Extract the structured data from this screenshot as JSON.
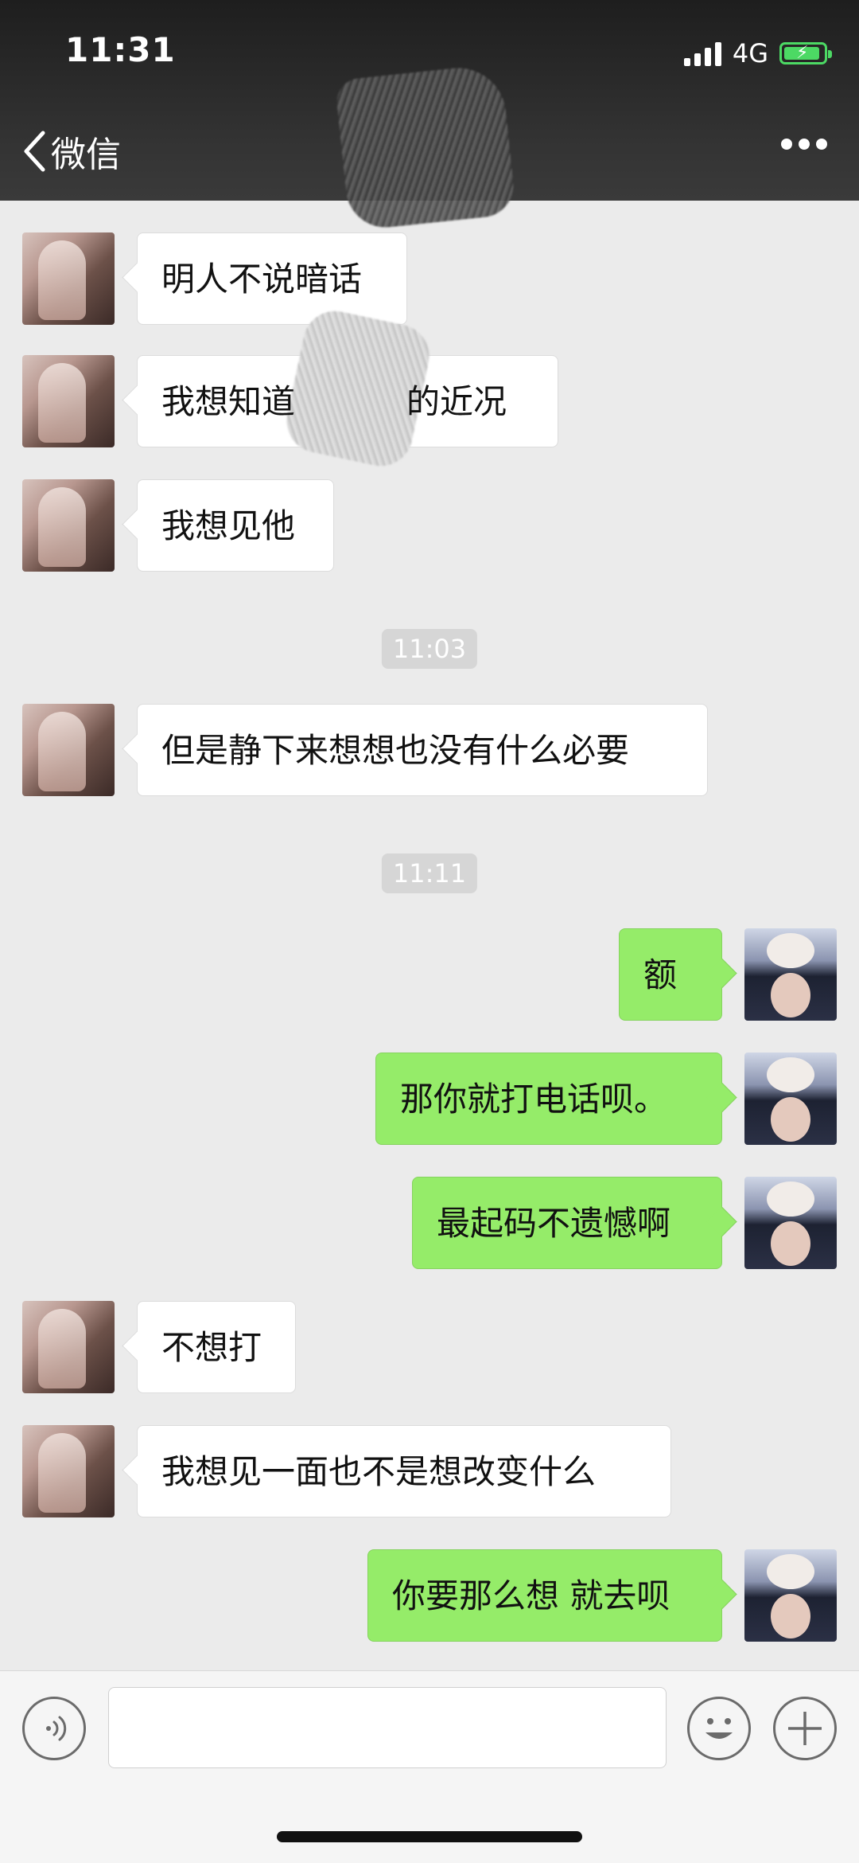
{
  "status_bar": {
    "time": "11:31",
    "network": "4G",
    "battery_color": "#4cd964"
  },
  "nav": {
    "back_label": "微信",
    "more_icon": "more-icon"
  },
  "messages": [
    {
      "side": "left",
      "text": "明人不说暗话"
    },
    {
      "side": "left",
      "text": "我想知道",
      "text_end": "的近况"
    },
    {
      "side": "left",
      "text": "我想见他"
    },
    {
      "type": "time",
      "text": "11:03"
    },
    {
      "side": "left",
      "text": "但是静下来想想也没有什么必要"
    },
    {
      "type": "time",
      "text": "11:11"
    },
    {
      "side": "right",
      "text": "额"
    },
    {
      "side": "right",
      "text": "那你就打电话呗。"
    },
    {
      "side": "right",
      "text": "最起码不遗憾啊"
    },
    {
      "side": "left",
      "text": "不想打"
    },
    {
      "side": "left",
      "text": "我想见一面也不是想改变什么"
    },
    {
      "side": "right",
      "text": "你要那么想 就去呗"
    }
  ],
  "colors": {
    "sent_bubble": "#95ec69",
    "received_bubble": "#ffffff",
    "chat_background": "#ebebeb"
  },
  "input_bar": {
    "voice_icon": "voice-icon",
    "emoji_icon": "emoji-icon",
    "plus_icon": "plus-icon"
  }
}
